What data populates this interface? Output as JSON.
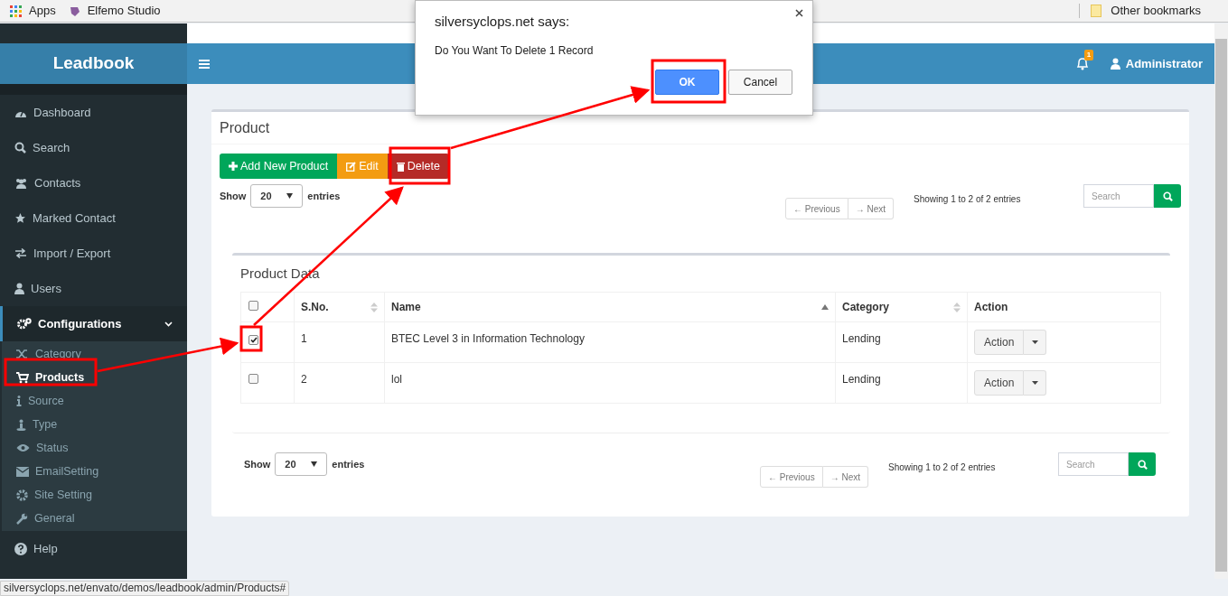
{
  "browser": {
    "bookmarks": [
      "Apps",
      "Elfemo Studio"
    ],
    "other_bookmarks": "Other bookmarks",
    "status_url": "silversyclops.net/envato/demos/leadbook/admin/Products#"
  },
  "header": {
    "logo": "Leadbook",
    "notification_count": "1",
    "user": "Administrator"
  },
  "sidebar": {
    "items": [
      {
        "label": "Dashboard",
        "selected": false
      },
      {
        "label": "Search",
        "selected": false
      },
      {
        "label": "Contacts",
        "selected": false
      },
      {
        "label": "Marked Contact",
        "selected": false
      },
      {
        "label": "Import / Export",
        "selected": false
      },
      {
        "label": "Users",
        "selected": false
      },
      {
        "label": "Configurations",
        "selected": true,
        "expanded": true,
        "children": [
          {
            "label": "Category",
            "selected": false
          },
          {
            "label": "Products",
            "selected": true
          },
          {
            "label": "Source",
            "selected": false
          },
          {
            "label": "Type",
            "selected": false
          },
          {
            "label": "Status",
            "selected": false
          },
          {
            "label": "EmailSetting",
            "selected": false
          },
          {
            "label": "Site Setting",
            "selected": false
          },
          {
            "label": "General",
            "selected": false
          }
        ]
      },
      {
        "label": "Help",
        "selected": false
      }
    ]
  },
  "dialog": {
    "title": "silversyclops.net says:",
    "message": "Do You Want To Delete 1 Record",
    "buttons": [
      {
        "label": "OK",
        "kind": "primary"
      },
      {
        "label": "Cancel",
        "kind": "secondary"
      }
    ]
  },
  "page": {
    "title": "Product",
    "toolbar": [
      {
        "label": "Add New Product",
        "kind": "add"
      },
      {
        "label": "Edit",
        "kind": "edit"
      },
      {
        "label": "Delete",
        "kind": "delete"
      }
    ],
    "top_controls": {
      "show_label": "Show",
      "entries": "20",
      "entries_label": "entries",
      "pagination": [
        "← Previous",
        "→ Next"
      ],
      "info": "Showing 1 to 2 of 2 entries",
      "search_placeholder": "Search"
    },
    "panel_title": "Product Data",
    "table": {
      "select_all_checked": false,
      "columns": [
        {
          "label": "S.No.",
          "sortable": true,
          "sorted": false
        },
        {
          "label": "Name",
          "sortable": true,
          "sorted": true
        },
        {
          "label": "Category",
          "sortable": true,
          "sorted": false
        },
        {
          "label": "Action",
          "sortable": false
        }
      ],
      "rows": [
        {
          "checked": true,
          "s_no": "1",
          "name": "BTEC Level 3 in Information Technology",
          "category": "Lending",
          "action": "Action"
        },
        {
          "checked": false,
          "s_no": "2",
          "name": "lol",
          "category": "Lending",
          "action": "Action"
        }
      ]
    },
    "bottom_controls": {
      "show_label": "Show",
      "entries": "20",
      "entries_label": "entries",
      "pagination": [
        "← Previous",
        "→ Next"
      ],
      "info": "Showing 1 to 2 of 2 entries",
      "search_placeholder": "Search"
    }
  }
}
